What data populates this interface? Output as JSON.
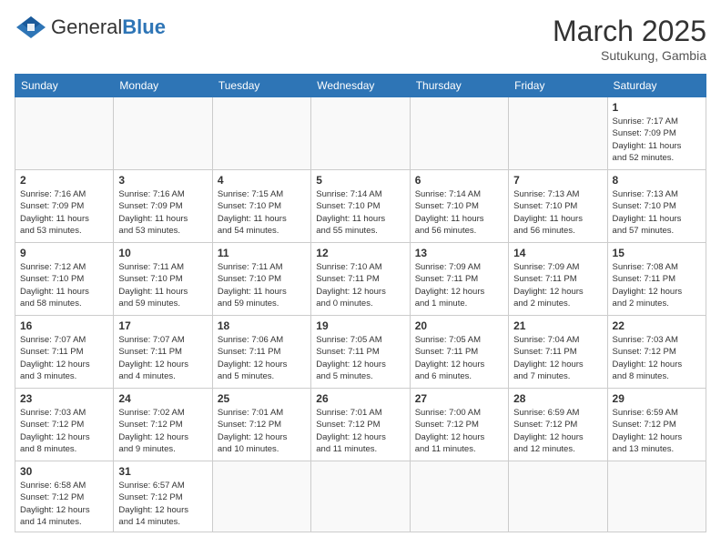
{
  "header": {
    "logo_general": "General",
    "logo_blue": "Blue",
    "month_year": "March 2025",
    "location": "Sutukung, Gambia"
  },
  "days_of_week": [
    "Sunday",
    "Monday",
    "Tuesday",
    "Wednesday",
    "Thursday",
    "Friday",
    "Saturday"
  ],
  "weeks": [
    [
      {
        "day": "",
        "info": ""
      },
      {
        "day": "",
        "info": ""
      },
      {
        "day": "",
        "info": ""
      },
      {
        "day": "",
        "info": ""
      },
      {
        "day": "",
        "info": ""
      },
      {
        "day": "",
        "info": ""
      },
      {
        "day": "1",
        "info": "Sunrise: 7:17 AM\nSunset: 7:09 PM\nDaylight: 11 hours\nand 52 minutes."
      }
    ],
    [
      {
        "day": "2",
        "info": "Sunrise: 7:16 AM\nSunset: 7:09 PM\nDaylight: 11 hours\nand 53 minutes."
      },
      {
        "day": "3",
        "info": "Sunrise: 7:16 AM\nSunset: 7:09 PM\nDaylight: 11 hours\nand 53 minutes."
      },
      {
        "day": "4",
        "info": "Sunrise: 7:15 AM\nSunset: 7:10 PM\nDaylight: 11 hours\nand 54 minutes."
      },
      {
        "day": "5",
        "info": "Sunrise: 7:14 AM\nSunset: 7:10 PM\nDaylight: 11 hours\nand 55 minutes."
      },
      {
        "day": "6",
        "info": "Sunrise: 7:14 AM\nSunset: 7:10 PM\nDaylight: 11 hours\nand 56 minutes."
      },
      {
        "day": "7",
        "info": "Sunrise: 7:13 AM\nSunset: 7:10 PM\nDaylight: 11 hours\nand 56 minutes."
      },
      {
        "day": "8",
        "info": "Sunrise: 7:13 AM\nSunset: 7:10 PM\nDaylight: 11 hours\nand 57 minutes."
      }
    ],
    [
      {
        "day": "9",
        "info": "Sunrise: 7:12 AM\nSunset: 7:10 PM\nDaylight: 11 hours\nand 58 minutes."
      },
      {
        "day": "10",
        "info": "Sunrise: 7:11 AM\nSunset: 7:10 PM\nDaylight: 11 hours\nand 59 minutes."
      },
      {
        "day": "11",
        "info": "Sunrise: 7:11 AM\nSunset: 7:10 PM\nDaylight: 11 hours\nand 59 minutes."
      },
      {
        "day": "12",
        "info": "Sunrise: 7:10 AM\nSunset: 7:11 PM\nDaylight: 12 hours\nand 0 minutes."
      },
      {
        "day": "13",
        "info": "Sunrise: 7:09 AM\nSunset: 7:11 PM\nDaylight: 12 hours\nand 1 minute."
      },
      {
        "day": "14",
        "info": "Sunrise: 7:09 AM\nSunset: 7:11 PM\nDaylight: 12 hours\nand 2 minutes."
      },
      {
        "day": "15",
        "info": "Sunrise: 7:08 AM\nSunset: 7:11 PM\nDaylight: 12 hours\nand 2 minutes."
      }
    ],
    [
      {
        "day": "16",
        "info": "Sunrise: 7:07 AM\nSunset: 7:11 PM\nDaylight: 12 hours\nand 3 minutes."
      },
      {
        "day": "17",
        "info": "Sunrise: 7:07 AM\nSunset: 7:11 PM\nDaylight: 12 hours\nand 4 minutes."
      },
      {
        "day": "18",
        "info": "Sunrise: 7:06 AM\nSunset: 7:11 PM\nDaylight: 12 hours\nand 5 minutes."
      },
      {
        "day": "19",
        "info": "Sunrise: 7:05 AM\nSunset: 7:11 PM\nDaylight: 12 hours\nand 5 minutes."
      },
      {
        "day": "20",
        "info": "Sunrise: 7:05 AM\nSunset: 7:11 PM\nDaylight: 12 hours\nand 6 minutes."
      },
      {
        "day": "21",
        "info": "Sunrise: 7:04 AM\nSunset: 7:11 PM\nDaylight: 12 hours\nand 7 minutes."
      },
      {
        "day": "22",
        "info": "Sunrise: 7:03 AM\nSunset: 7:12 PM\nDaylight: 12 hours\nand 8 minutes."
      }
    ],
    [
      {
        "day": "23",
        "info": "Sunrise: 7:03 AM\nSunset: 7:12 PM\nDaylight: 12 hours\nand 8 minutes."
      },
      {
        "day": "24",
        "info": "Sunrise: 7:02 AM\nSunset: 7:12 PM\nDaylight: 12 hours\nand 9 minutes."
      },
      {
        "day": "25",
        "info": "Sunrise: 7:01 AM\nSunset: 7:12 PM\nDaylight: 12 hours\nand 10 minutes."
      },
      {
        "day": "26",
        "info": "Sunrise: 7:01 AM\nSunset: 7:12 PM\nDaylight: 12 hours\nand 11 minutes."
      },
      {
        "day": "27",
        "info": "Sunrise: 7:00 AM\nSunset: 7:12 PM\nDaylight: 12 hours\nand 11 minutes."
      },
      {
        "day": "28",
        "info": "Sunrise: 6:59 AM\nSunset: 7:12 PM\nDaylight: 12 hours\nand 12 minutes."
      },
      {
        "day": "29",
        "info": "Sunrise: 6:59 AM\nSunset: 7:12 PM\nDaylight: 12 hours\nand 13 minutes."
      }
    ],
    [
      {
        "day": "30",
        "info": "Sunrise: 6:58 AM\nSunset: 7:12 PM\nDaylight: 12 hours\nand 14 minutes."
      },
      {
        "day": "31",
        "info": "Sunrise: 6:57 AM\nSunset: 7:12 PM\nDaylight: 12 hours\nand 14 minutes."
      },
      {
        "day": "",
        "info": ""
      },
      {
        "day": "",
        "info": ""
      },
      {
        "day": "",
        "info": ""
      },
      {
        "day": "",
        "info": ""
      },
      {
        "day": "",
        "info": ""
      }
    ]
  ]
}
